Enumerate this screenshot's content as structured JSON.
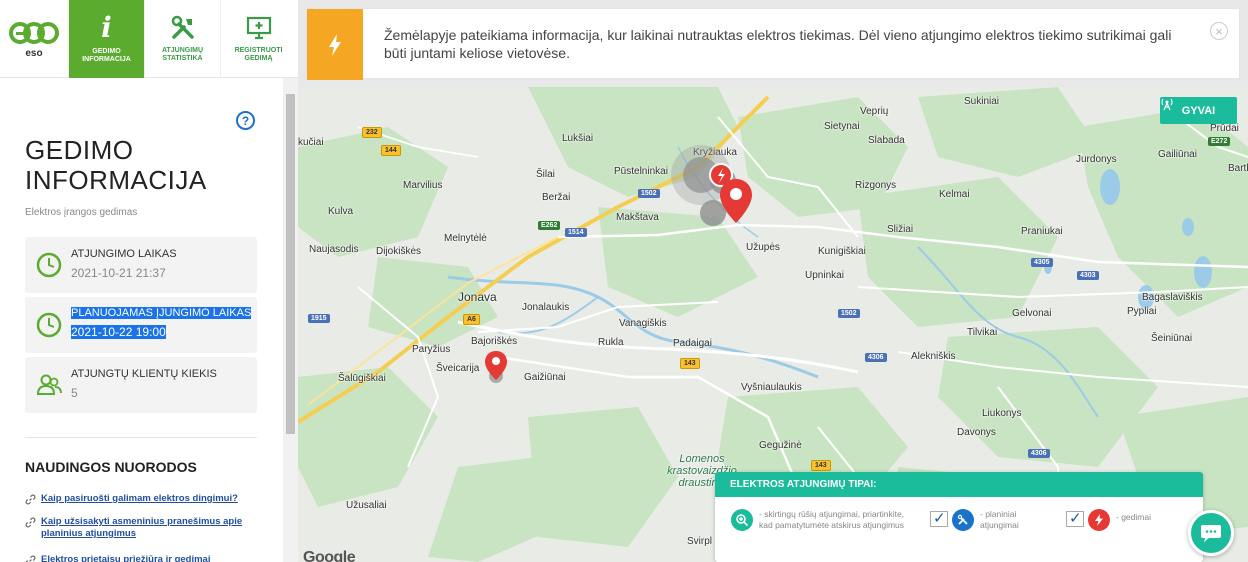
{
  "nav": {
    "logo_text": "eso",
    "tabs": [
      {
        "label": "Gedimo informacija",
        "icon": "info-icon",
        "active": true
      },
      {
        "label": "Atjungimų statistika",
        "icon": "tools-icon",
        "active": false
      },
      {
        "label": "Registruoti gedimą",
        "icon": "monitor-plus-icon",
        "active": false
      }
    ]
  },
  "sidebar": {
    "help_label": "?",
    "title": "GEDIMO INFORMACIJA",
    "subtitle": "Elektros įrangos gedimas",
    "cards": [
      {
        "label": "ATJUNGIMO LAIKAS",
        "value": "2021-10-21 21:37",
        "icon": "clock-icon"
      },
      {
        "label": "PLANUOJAMAS ĮJUNGIMO LAIKAS",
        "value": "2021-10-22 19:00",
        "icon": "clock-icon"
      },
      {
        "label": "ATJUNGTŲ KLIENTŲ KIEKIS",
        "value": "5",
        "icon": "users-icon"
      }
    ],
    "links_title": "NAUDINGOS NUORODOS",
    "links": [
      "Kaip pasiruošti galimam elektros dingimui?",
      "Kaip užsisakyti asmeninius pranešimus apie planinius atjungimus",
      "Elektros prietaisų priežiūra ir gedimai"
    ]
  },
  "banner": {
    "message": "Žemėlapyje pateikiama informacija, kur laikinai nutrauktas elektros tiekimas. Dėl vieno atjungimo elektros tiekimo sutrikimai gali būti juntami keliose vietovėse.",
    "close_label": "×",
    "accent_color": "#f5a623"
  },
  "map": {
    "live_label": "GYVAI",
    "google_label": "Google",
    "places": [
      {
        "name": "Kryžiauka"
      },
      {
        "name": "Veprių"
      },
      {
        "name": "Sukiniai"
      },
      {
        "name": "Sietynai"
      },
      {
        "name": "Prūdai"
      },
      {
        "name": "Lukšiai"
      },
      {
        "name": "Slabada"
      },
      {
        "name": "Jurdonys"
      },
      {
        "name": "Gailiūnai"
      },
      {
        "name": "Bartkū"
      },
      {
        "name": "Šilai"
      },
      {
        "name": "Pūstelninkai"
      },
      {
        "name": "Marvilius"
      },
      {
        "name": "Beržai"
      },
      {
        "name": "Rizgonys"
      },
      {
        "name": "Kelmai"
      },
      {
        "name": "Kulva"
      },
      {
        "name": "Makštava"
      },
      {
        "name": "Sližiai"
      },
      {
        "name": "Praniukai"
      },
      {
        "name": "Naujasodis"
      },
      {
        "name": "Dijokiškės"
      },
      {
        "name": "Melnytėlė"
      },
      {
        "name": "Užupės"
      },
      {
        "name": "Kunigiškiai"
      },
      {
        "name": "Upninkai"
      },
      {
        "name": "Bagaslaviškis"
      },
      {
        "name": "Jonava"
      },
      {
        "name": "Jonalaukis"
      },
      {
        "name": "Pypliai"
      },
      {
        "name": "Gelvonai"
      },
      {
        "name": "Vanagiškis"
      },
      {
        "name": "Šeiniūnai"
      },
      {
        "name": "Tilvikai"
      },
      {
        "name": "Paryžius"
      },
      {
        "name": "Bajoriškės"
      },
      {
        "name": "Rukla"
      },
      {
        "name": "Padaigai"
      },
      {
        "name": "Alekniškis"
      },
      {
        "name": "Šveicarija"
      },
      {
        "name": "Šalūgiškiai"
      },
      {
        "name": "Gaižiūnai"
      },
      {
        "name": "Vyšniaulaukis"
      },
      {
        "name": "Liukonys"
      },
      {
        "name": "Davonys"
      },
      {
        "name": "Gegužinė"
      },
      {
        "name": "Lomenos krastovaizdžio draustinis"
      },
      {
        "name": "Užusaliai"
      },
      {
        "name": "Svirpl"
      },
      {
        "name": "kučiai"
      }
    ],
    "roads": [
      "232",
      "144",
      "1502",
      "E262",
      "1514",
      "A6",
      "1915",
      "143",
      "1502",
      "4305",
      "4303",
      "4306",
      "4306",
      "143",
      "E272"
    ]
  },
  "legend": {
    "title": "ELEKTROS ATJUNGIMŲ TIPAI:",
    "items": [
      {
        "text": "- skirtingų rūšių atjungimai, priartinkite, kad pamatytumėte atskirus atjungimus",
        "icon": "zoom-in-icon",
        "color": "#1abc9c"
      },
      {
        "text": "- planiniai atjungimai",
        "icon": "tools-icon",
        "color": "#1a73c8"
      },
      {
        "text": "- gedimai",
        "icon": "lightning-icon",
        "color": "#e53935"
      }
    ]
  },
  "colors": {
    "green": "#5aab2e",
    "teal": "#1abc9c",
    "highlight": "#1a73e8",
    "marker_red": "#e53935"
  }
}
